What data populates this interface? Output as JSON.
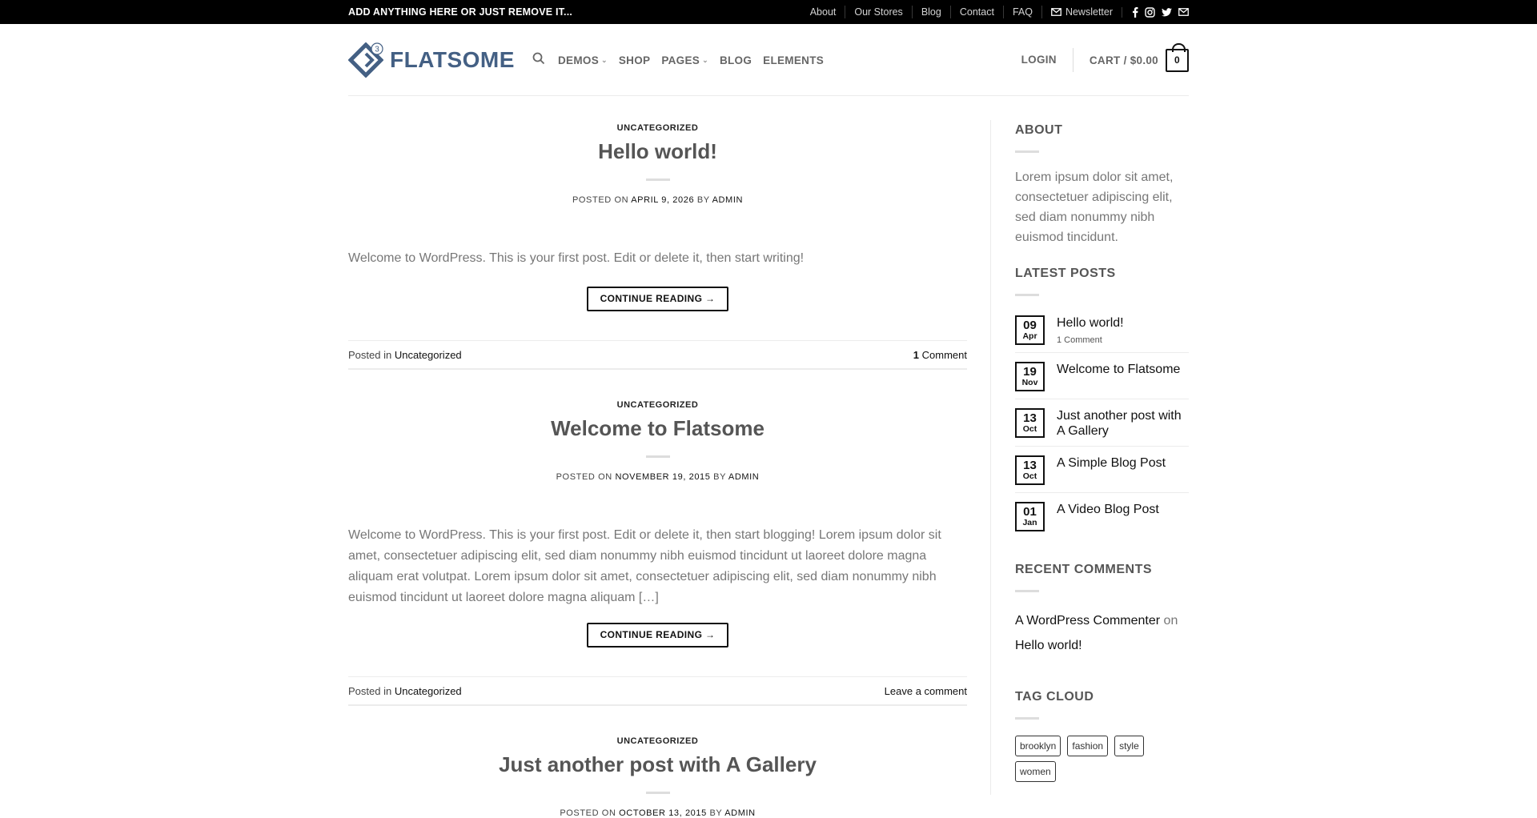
{
  "topbar": {
    "message": "ADD ANYTHING HERE OR JUST REMOVE IT...",
    "links": [
      "About",
      "Our Stores",
      "Blog",
      "Contact",
      "FAQ"
    ],
    "newsletter": "Newsletter",
    "social_icons": [
      "facebook-icon",
      "instagram-icon",
      "twitter-icon",
      "envelope-icon"
    ]
  },
  "header": {
    "logo_text": "FLATSOME",
    "logo_badge": "3",
    "nav": [
      {
        "label": "DEMOS",
        "has_dropdown": true
      },
      {
        "label": "SHOP",
        "has_dropdown": false
      },
      {
        "label": "PAGES",
        "has_dropdown": true
      },
      {
        "label": "BLOG",
        "has_dropdown": false
      },
      {
        "label": "ELEMENTS",
        "has_dropdown": false
      }
    ],
    "login": "LOGIN",
    "cart_label": "CART / $0.00",
    "cart_count": "0"
  },
  "posts": [
    {
      "category": "UNCATEGORIZED",
      "title": "Hello world!",
      "posted_on": "POSTED ON",
      "date": "APRIL 9, 2026",
      "by": "BY",
      "author": "ADMIN",
      "excerpt": "Welcome to WordPress. This is your first post. Edit or delete it, then start writing!",
      "button": "CONTINUE READING →",
      "posted_in": "Posted in",
      "posted_in_cat": "Uncategorized",
      "comments_count": "1",
      "comments_label": "Comment"
    },
    {
      "category": "UNCATEGORIZED",
      "title": "Welcome to Flatsome",
      "posted_on": "POSTED ON",
      "date": "NOVEMBER 19, 2015",
      "by": "BY",
      "author": "ADMIN",
      "excerpt": "Welcome to WordPress. This is your first post. Edit or delete it, then start blogging! Lorem ipsum dolor sit amet, consectetuer adipiscing elit, sed diam nonummy nibh euismod tincidunt ut laoreet dolore magna aliquam erat volutpat. Lorem ipsum dolor sit amet, consectetuer adipiscing elit, sed diam nonummy nibh euismod tincidunt ut laoreet dolore magna aliquam […]",
      "button": "CONTINUE READING →",
      "posted_in": "Posted in",
      "posted_in_cat": "Uncategorized",
      "leave_comment": "Leave a comment"
    },
    {
      "category": "UNCATEGORIZED",
      "title": "Just another post with A Gallery",
      "posted_on": "POSTED ON",
      "date": "OCTOBER 13, 2015",
      "by": "BY",
      "author": "ADMIN"
    }
  ],
  "sidebar": {
    "about_title": "ABOUT",
    "about_text": "Lorem ipsum dolor sit amet, consectetuer adipiscing elit, sed diam nonummy nibh euismod tincidunt.",
    "latest_title": "LATEST POSTS",
    "latest": [
      {
        "day": "09",
        "month": "Apr",
        "title": "Hello world!",
        "sub": "1 Comment"
      },
      {
        "day": "19",
        "month": "Nov",
        "title": "Welcome to Flatsome"
      },
      {
        "day": "13",
        "month": "Oct",
        "title": "Just another post with A Gallery"
      },
      {
        "day": "13",
        "month": "Oct",
        "title": "A Simple Blog Post"
      },
      {
        "day": "01",
        "month": "Jan",
        "title": "A Video Blog Post"
      }
    ],
    "comments_title": "RECENT COMMENTS",
    "comment_author": "A WordPress Commenter",
    "comment_on": "on",
    "comment_post": "Hello world!",
    "tags_title": "TAG CLOUD",
    "tags": [
      "brooklyn",
      "fashion",
      "style",
      "women"
    ]
  },
  "colors": {
    "brand": "#446084",
    "topbar_bg": "#000000"
  }
}
